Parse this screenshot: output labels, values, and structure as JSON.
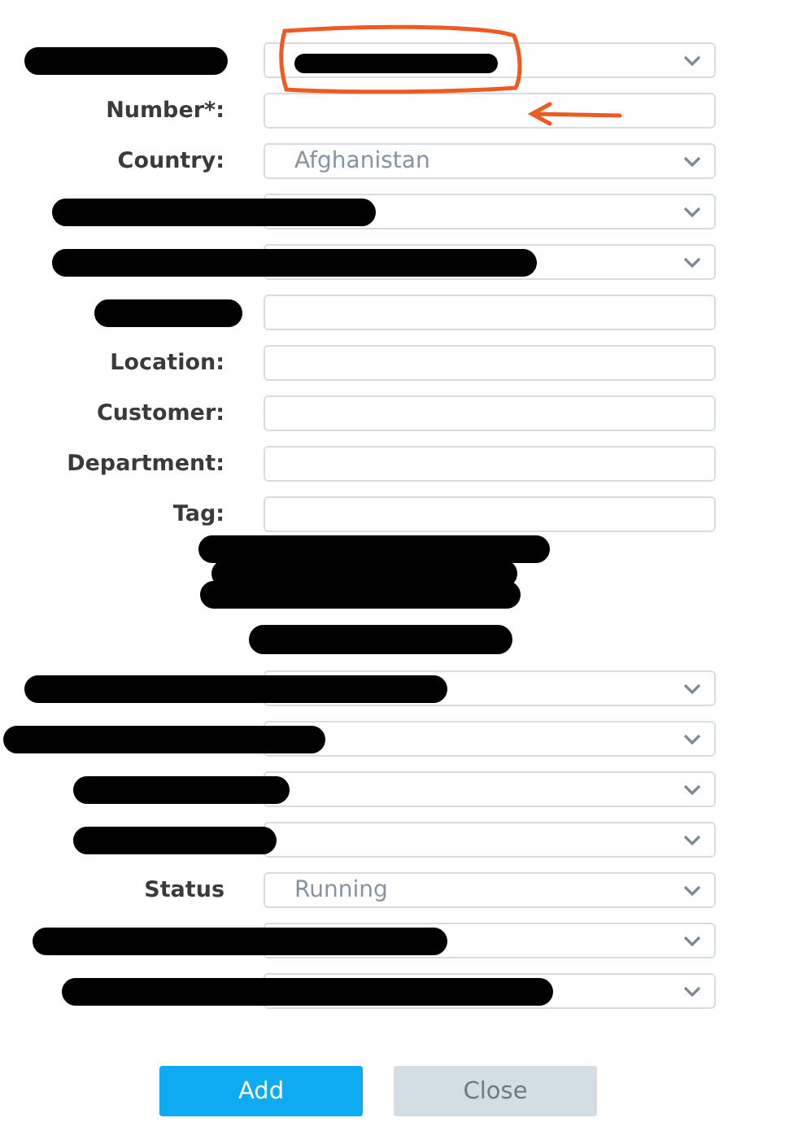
{
  "fields": [
    {
      "kind": "select",
      "redacted": true,
      "value_redacted": true
    },
    {
      "kind": "input",
      "label": "Number*:"
    },
    {
      "kind": "select",
      "label": "Country:",
      "value": "Afghanistan"
    },
    {
      "kind": "select",
      "redacted": true
    },
    {
      "kind": "select",
      "redacted": true
    },
    {
      "kind": "input",
      "redacted": true
    },
    {
      "kind": "input",
      "label": "Location:"
    },
    {
      "kind": "input",
      "label": "Customer:"
    },
    {
      "kind": "input",
      "label": "Department:"
    },
    {
      "kind": "input",
      "label": "Tag:"
    },
    {
      "kind": "section",
      "redacted": true
    },
    {
      "kind": "select",
      "redacted": true
    },
    {
      "kind": "select",
      "redacted": true
    },
    {
      "kind": "select",
      "redacted": true
    },
    {
      "kind": "select",
      "redacted": true
    },
    {
      "kind": "select",
      "label": "Status",
      "value": "Running"
    },
    {
      "kind": "select",
      "redacted": true
    },
    {
      "kind": "select",
      "redacted": true
    }
  ],
  "buttons": [
    {
      "label": "Add",
      "disabled": false
    },
    {
      "label": "Close",
      "disabled": true
    }
  ],
  "annotations": [
    {
      "kind": "circle"
    },
    {
      "kind": "arrow"
    }
  ]
}
